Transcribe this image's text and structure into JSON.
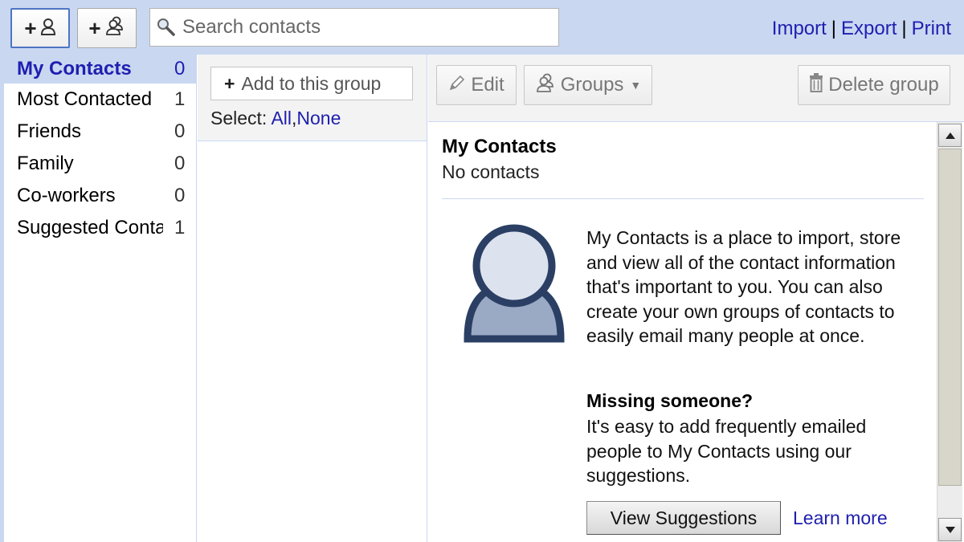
{
  "toolbar": {
    "search_placeholder": "Search contacts",
    "links": [
      "Import",
      "Export",
      "Print"
    ],
    "add_contact_plus": "+",
    "add_group_plus": "+"
  },
  "groups": [
    {
      "name": "My Contacts",
      "count": "0",
      "selected": true
    },
    {
      "name": "Most Contacted",
      "count": "1"
    },
    {
      "name": "Friends",
      "count": "0"
    },
    {
      "name": "Family",
      "count": "0"
    },
    {
      "name": "Co-workers",
      "count": "0"
    },
    {
      "name": "Suggested Contacts",
      "count": "1"
    }
  ],
  "middle": {
    "add_to_group_label": "Add to this group",
    "add_plus": "+",
    "select_label": "Select:",
    "select_all": "All",
    "select_sep": ",",
    "select_none": "None"
  },
  "actions": {
    "edit_label": "Edit",
    "groups_label": "Groups",
    "delete_group_label": "Delete group"
  },
  "content": {
    "title": "My Contacts",
    "subtitle": "No contacts",
    "description": "My Contacts is a place to import, store and view all of the contact information that's important to you. You can also create your own groups of contacts to easily email many people at once.",
    "missing_title": "Missing someone?",
    "missing_text": "It's easy to add frequently emailed people to My Contacts using our suggestions.",
    "view_suggestions_label": "View Suggestions",
    "learn_more_label": "Learn more"
  },
  "icons": {
    "add_contact": "person-icon",
    "add_group": "people-icon",
    "search": "search-icon",
    "edit": "pencil-icon",
    "groups": "people-icon",
    "delete": "trash-icon",
    "avatar": "person-avatar"
  },
  "colors": {
    "chrome_blue": "#c9d7f1",
    "link_blue": "#1f1fb0",
    "avatar_dark": "#2b3f64",
    "avatar_light": "#dde3ee",
    "avatar_mid": "#9aa9c4"
  }
}
